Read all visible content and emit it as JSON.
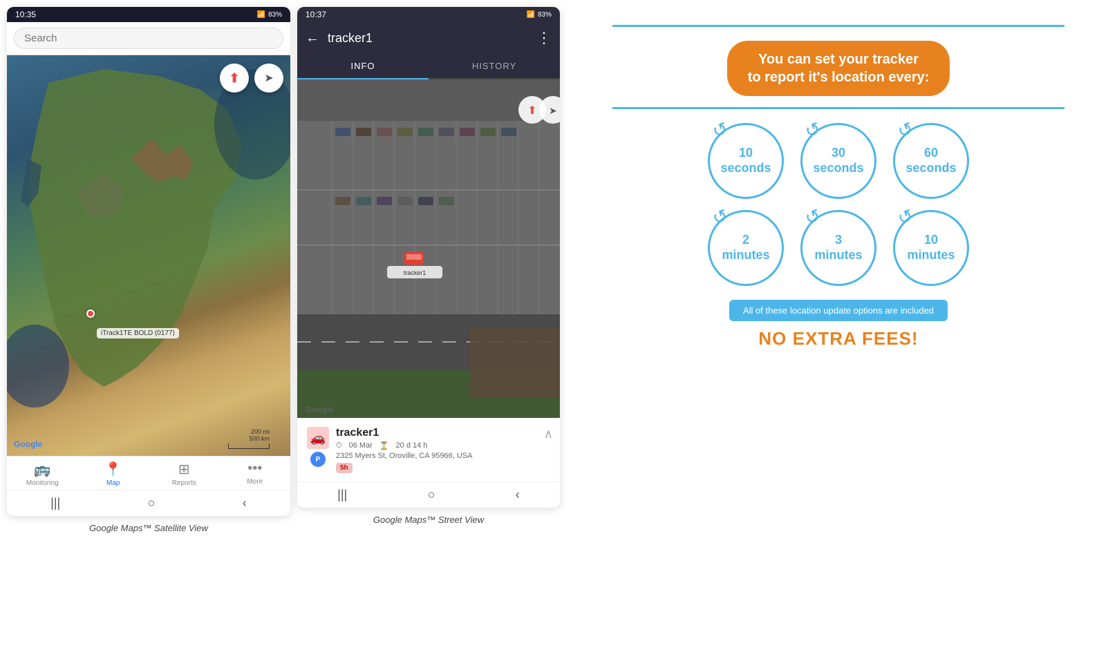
{
  "phone1": {
    "status_time": "10:35",
    "status_battery": "83%",
    "search_placeholder": "Search",
    "compass_icon": "⬆",
    "share_icon": "➤",
    "tracker_label": "iTrack1TE BOLD (0177)",
    "google_label": "Google",
    "scale_200mi": "200 mi",
    "scale_500km": "500 km",
    "nav_items": [
      {
        "label": "Monitoring",
        "icon": "🚌",
        "active": false
      },
      {
        "label": "Map",
        "icon": "📍",
        "active": true
      },
      {
        "label": "Reports",
        "icon": "⊞",
        "active": false
      },
      {
        "label": "More",
        "icon": "•••",
        "active": false
      }
    ],
    "caption": "Google Maps™ Satellite View"
  },
  "phone2": {
    "status_time": "10:37",
    "status_battery": "83%",
    "back_icon": "←",
    "title": "tracker1",
    "menu_icon": "⋮",
    "tabs": [
      {
        "label": "INFO",
        "active": true
      },
      {
        "label": "HISTORY",
        "active": false
      }
    ],
    "google_label": "Google",
    "tracker_name": "tracker1",
    "tracker_date": "06 Mar",
    "tracker_duration": "20 d 14 h",
    "tracker_address": "2325 Myers St, Oroville, CA 95966, USA",
    "badge": "5h",
    "caption": "Google Maps™ Street View"
  },
  "info_panel": {
    "header_text": "You can set your tracker\nto report it's location every:",
    "teal_line": true,
    "circles": [
      {
        "number": "10",
        "unit": "seconds"
      },
      {
        "number": "30",
        "unit": "seconds"
      },
      {
        "number": "60",
        "unit": "seconds"
      },
      {
        "number": "2",
        "unit": "minutes"
      },
      {
        "number": "3",
        "unit": "minutes"
      },
      {
        "number": "10",
        "unit": "minutes"
      }
    ],
    "included_text": "All of these location update options are included",
    "no_fees_text": "NO EXTRA FEES!",
    "accent_color": "#e8821e",
    "teal_color": "#4db6e8"
  }
}
